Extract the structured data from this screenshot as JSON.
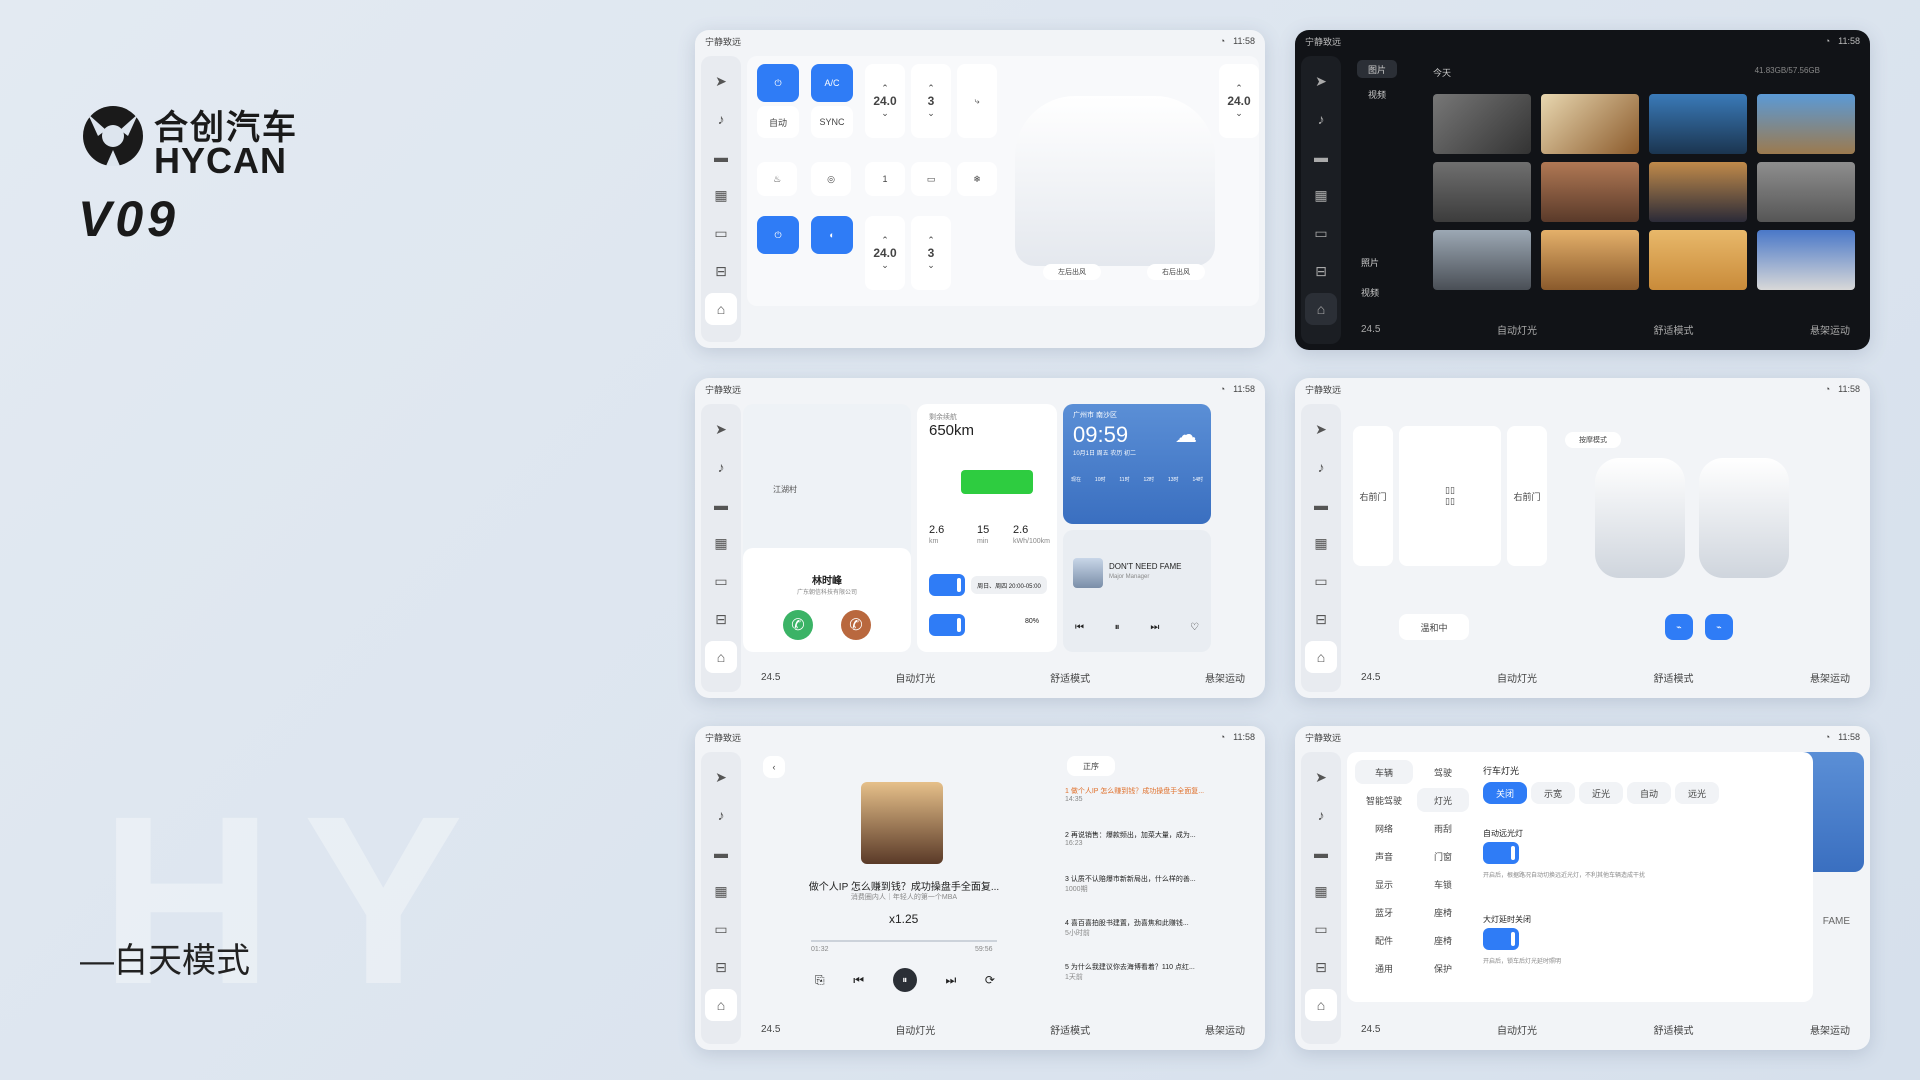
{
  "brand": {
    "cn": "合创汽车",
    "en": "HYCAN",
    "model": "V09",
    "mode": "—白天模式",
    "watermark": "HY"
  },
  "status": {
    "title": "宁静致远",
    "time": "11:58"
  },
  "rail": {
    "icons": [
      "navigation-icon",
      "music-icon",
      "camera-icon",
      "apps-icon",
      "car-icon",
      "toggle-icon",
      "home-icon"
    ]
  },
  "dock": {
    "temp": "24.5",
    "labels": [
      "自动灯光",
      "舒适模式",
      "悬架运动"
    ]
  },
  "climate": {
    "ac": "A/C",
    "sync": "SYNC",
    "temp_left": "24.0",
    "temp_right": "24.0",
    "fan_left": "3",
    "fan_left2": "3",
    "temp_left2": "24.0",
    "auto_lbl": "自动",
    "side_left": "左后出风",
    "side_right": "右后出风",
    "reset": "1"
  },
  "gallery": {
    "tab1": "图片",
    "tab2": "视频",
    "today": "今天",
    "storage": "41.83GB/57.56GB",
    "side1": "照片",
    "side2": "视频"
  },
  "nav": {
    "place": "江湖村",
    "caller": "林时峰",
    "caller_sub": "广东朝信科技有限公司"
  },
  "energy": {
    "label": "剩余续航",
    "range": "650km",
    "stat1": "2.6",
    "stat1u": "km",
    "stat2": "15",
    "stat2u": "min",
    "stat3": "2.6",
    "stat3u": "kWh/100km",
    "schedule": "周日、周四 20:00-05:00",
    "pct": "80%"
  },
  "weather": {
    "city": "广州市 南沙区",
    "time": "09:59",
    "date": "10月1日 周五 农历 初二",
    "hours": [
      "现在",
      "10时",
      "11时",
      "12时",
      "13时",
      "14时"
    ]
  },
  "music": {
    "song": "DON'T NEED FAME",
    "artist": "Major Manager"
  },
  "seat": {
    "mode": "按摩模式",
    "left": "右前门",
    "right": "右前门",
    "level": "温和中"
  },
  "podcast": {
    "title": "做个人IP 怎么赚到钱？成功操盘手全面复...",
    "sub": "消费圈内人｜年轻人的第一个MBA",
    "speed": "x1.25",
    "t1": "01:32",
    "t2": "59:56",
    "sort": "正序",
    "items": [
      {
        "n": "1",
        "t": "做个人IP 怎么赚到钱？成功操盘手全面复...",
        "m": "14:35"
      },
      {
        "n": "2",
        "t": "再说销售：爆款频出，加菜大量，成为...",
        "m": "16:23"
      },
      {
        "n": "3",
        "t": "认质不认赔爆市新新局出，什么样的善...",
        "m": "1000期"
      },
      {
        "n": "4",
        "t": "喜百喜拍股书建置，劲喜焦和此赚钱...",
        "m": "5小时前"
      },
      {
        "n": "5",
        "t": "为什么我建议你去海博看着？110 点红...",
        "m": "1天前"
      }
    ]
  },
  "settings": {
    "menu_left": [
      "车辆",
      "智能驾驶",
      "网络",
      "声音",
      "显示",
      "蓝牙",
      "配件",
      "通用"
    ],
    "menu_right": [
      "驾驶",
      "灯光",
      "雨刮",
      "门窗",
      "车锁",
      "座椅",
      "座椅",
      "保护"
    ],
    "section": "行车灯光",
    "options": [
      "关闭",
      "示宽",
      "近光",
      "自动",
      "远光"
    ],
    "auto_high": "自动远光灯",
    "auto_high_desc": "开启后，根据路况自动切换远近光灯，不利其他车辆造成干扰",
    "follow": "大灯延时关闭",
    "follow_desc": "开启后，锁车后灯光延时照明",
    "fame": "FAME"
  }
}
